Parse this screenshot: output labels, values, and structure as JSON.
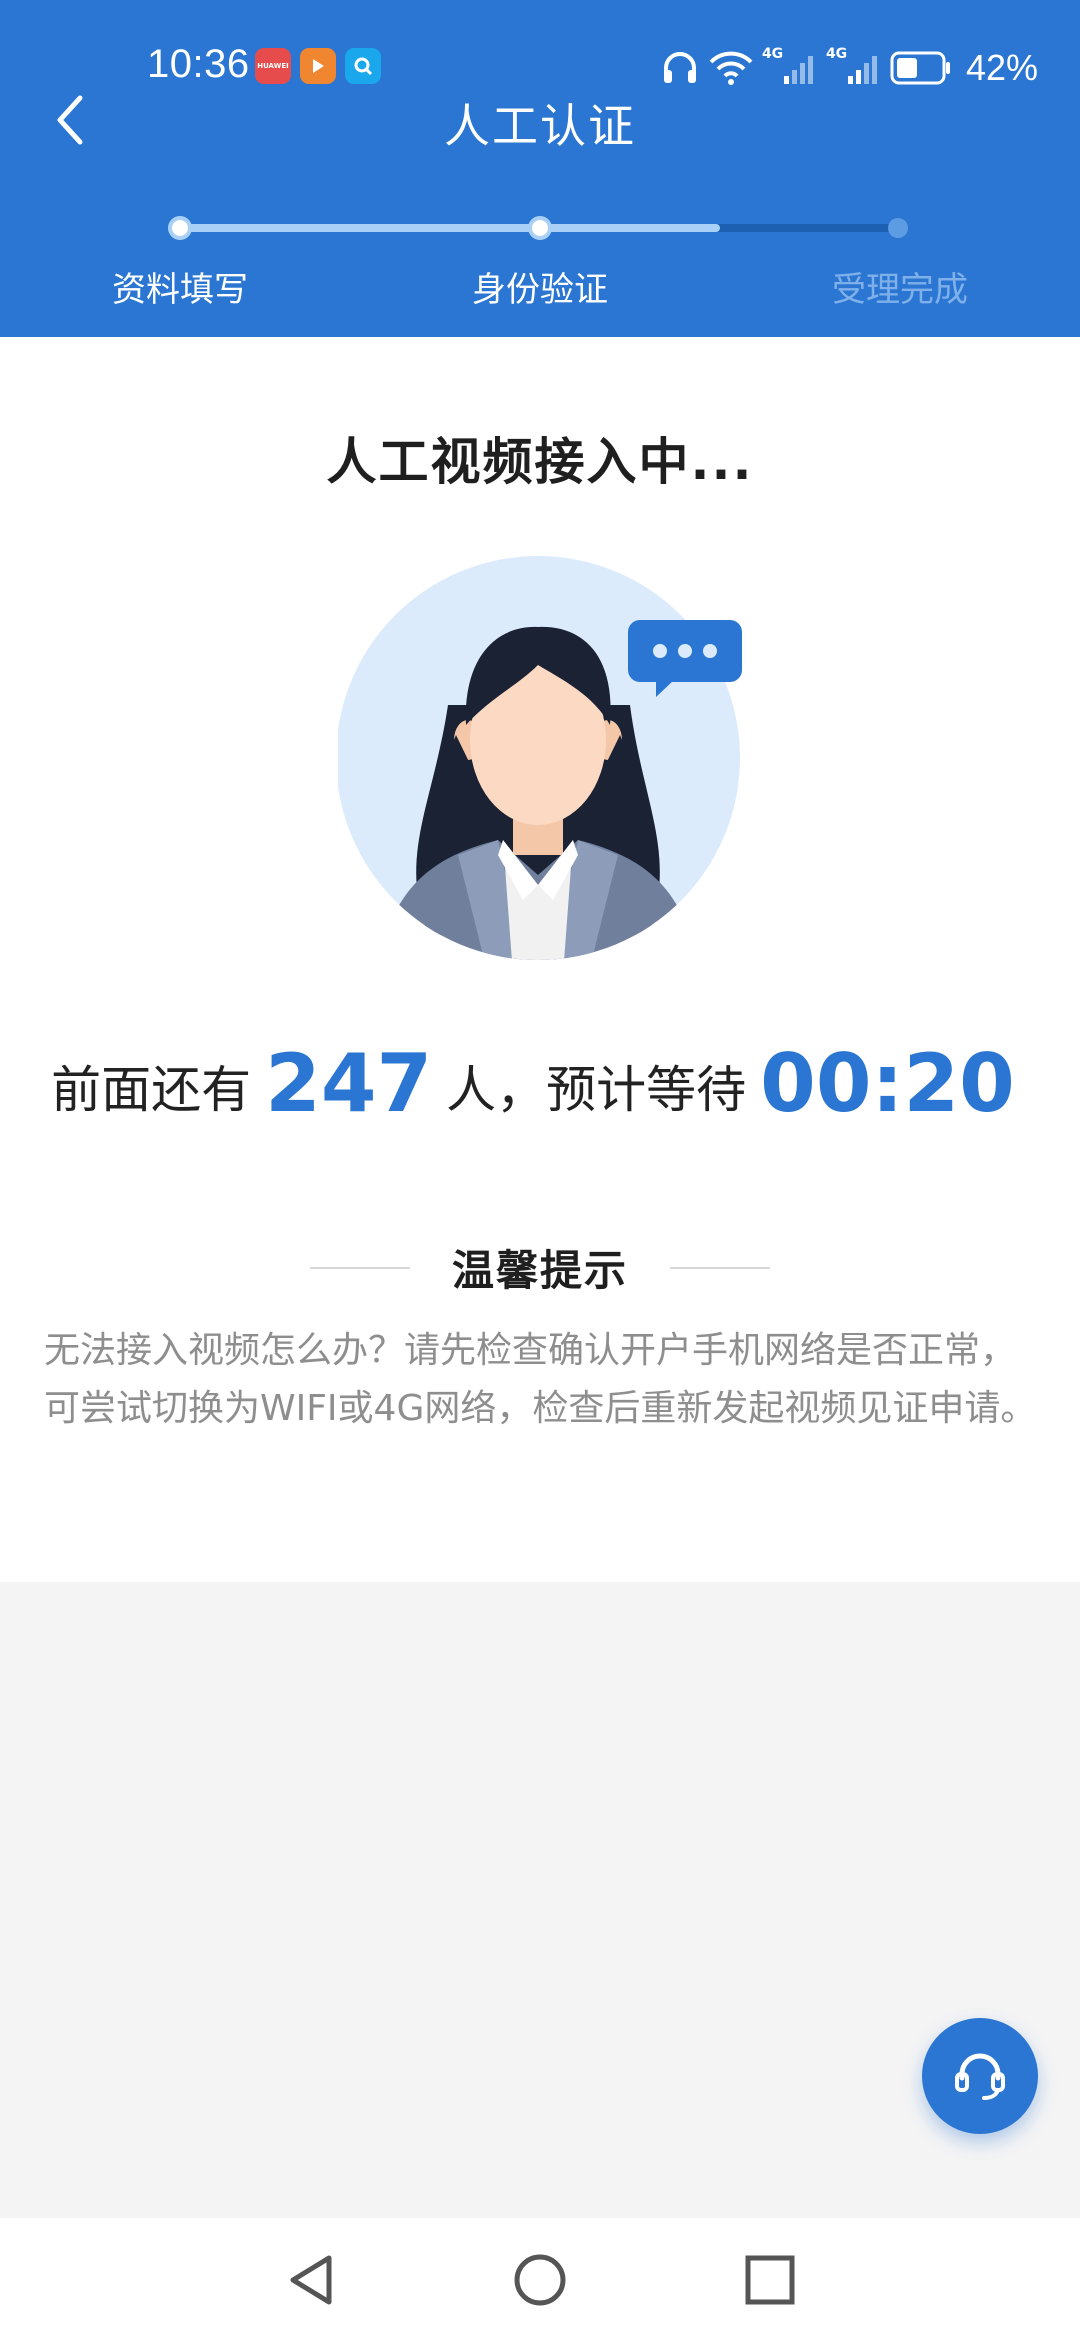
{
  "status_bar": {
    "time": "10:36",
    "battery": "42%",
    "network_1": "4G",
    "network_2": "4G",
    "app_icons": [
      "huawei-mall-icon",
      "video-app-icon",
      "search-app-icon"
    ],
    "app_icon_text": "HUAWEI"
  },
  "nav": {
    "title": "人工认证",
    "back_icon": "chevron-left-icon"
  },
  "stepper": {
    "steps": [
      {
        "label": "资料填写",
        "state": "done"
      },
      {
        "label": "身份验证",
        "state": "current"
      },
      {
        "label": "受理完成",
        "state": "pending"
      }
    ],
    "progress_fraction": 0.75
  },
  "main": {
    "connecting_title": "人工视频接入中...",
    "queue_prefix": "前面还有",
    "queue_count": "247",
    "queue_middle": "人，预计等待",
    "wait_time": "00:20",
    "tip_heading": "温馨提示",
    "tip_body": "无法接入视频怎么办？请先检查确认开户手机网络是否正常，可尝试切换为WIFI或4G网络，检查后重新发起视频见证申请。"
  },
  "support": {
    "icon": "headset-icon"
  },
  "system_nav": {
    "buttons": [
      "back-triangle-icon",
      "home-circle-icon",
      "recents-square-icon"
    ]
  },
  "colors": {
    "primary": "#2a76d2",
    "page_bg": "#f4f4f5",
    "tip_text": "#8e8e8e",
    "pending_step": "#a9c8ef"
  }
}
